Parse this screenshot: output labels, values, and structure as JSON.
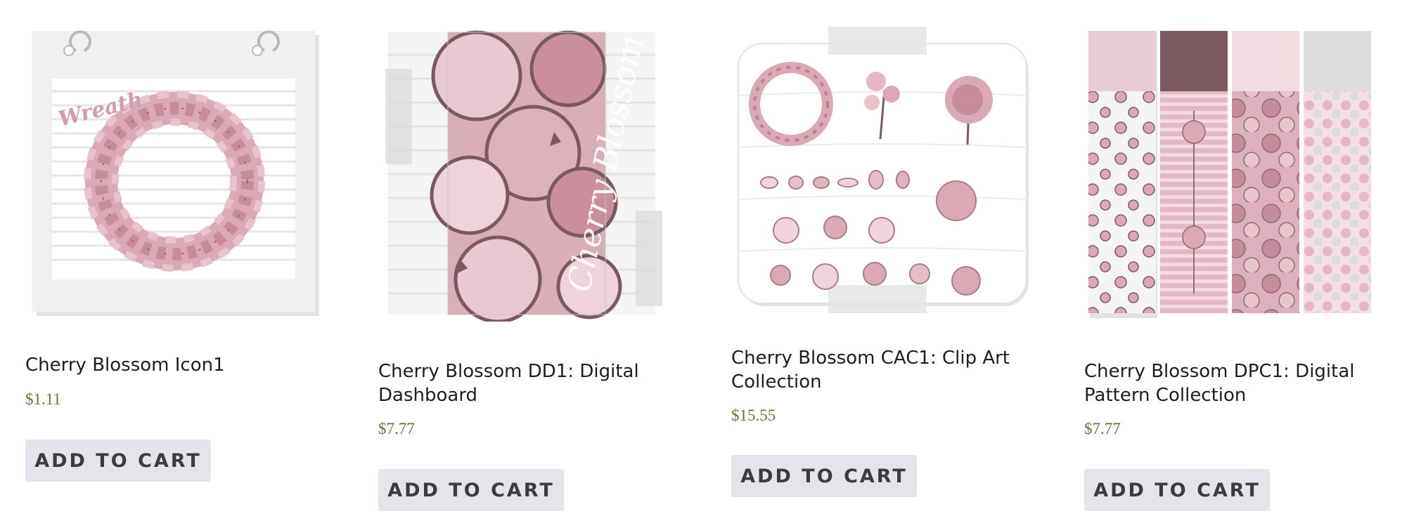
{
  "products": [
    {
      "title": "Cherry Blossom Icon1",
      "price": "$1.11",
      "button": "ADD TO CART",
      "image_text": "Wreath"
    },
    {
      "title": "Cherry Blossom DD1: Digital Dashboard",
      "price": "$7.77",
      "button": "ADD TO CART",
      "image_text": "Cherry Blossom"
    },
    {
      "title": "Cherry Blossom CAC1: Clip Art Collection",
      "price": "$15.55",
      "button": "ADD TO CART",
      "image_text": ""
    },
    {
      "title": "Cherry Blossom DPC1: Digital Pattern Collection",
      "price": "$7.77",
      "button": "ADD TO CART",
      "image_text": ""
    }
  ],
  "colors": {
    "title": "#1e1e1e",
    "price": "#6f6f3c",
    "button_bg": "#e6e3ea",
    "button_text": "#3c3c3c",
    "blossom_pink": "#d9a9b6",
    "blossom_dark": "#7a5a60"
  }
}
